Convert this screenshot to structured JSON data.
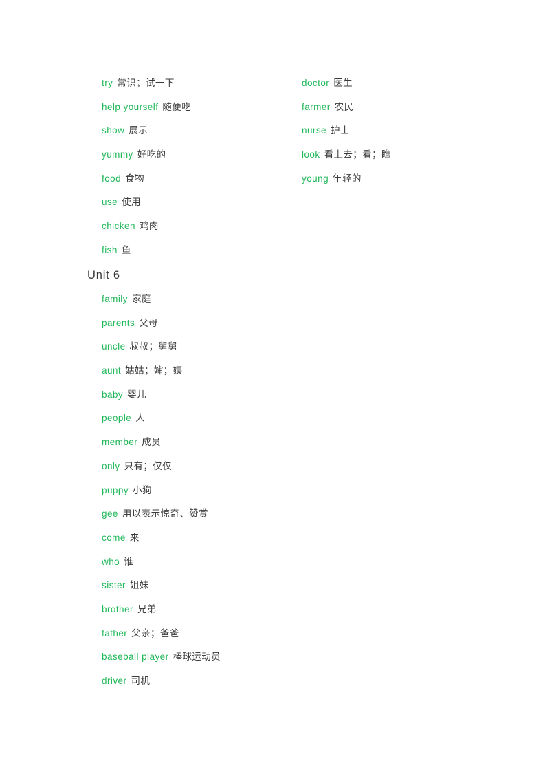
{
  "page": {
    "background_color": "#ffffff",
    "term_color": "#21b85a",
    "gloss_color": "#3b3b3b",
    "heading_color": "#3a3a3a"
  },
  "top_section": {
    "left_column": [
      {
        "term": "try",
        "gloss": "常识；试一下",
        "underlined": false
      },
      {
        "term": "help  yourself",
        "gloss": "随便吃",
        "underlined": false
      },
      {
        "term": "show",
        "gloss": "展示",
        "underlined": false
      },
      {
        "term": "yummy",
        "gloss": "好吃的",
        "underlined": false
      },
      {
        "term": "food",
        "gloss": "食物",
        "underlined": false
      },
      {
        "term": "use",
        "gloss": "使用",
        "underlined": false
      },
      {
        "term": "chicken",
        "gloss": "鸡肉",
        "underlined": false
      },
      {
        "term": "fish",
        "gloss": "鱼",
        "underlined": true
      }
    ],
    "right_column": [
      {
        "term": "doctor",
        "gloss": "医生",
        "underlined": false
      },
      {
        "term": "farmer",
        "gloss": "农民",
        "underlined": false
      },
      {
        "term": "nurse",
        "gloss": "护士",
        "underlined": false
      },
      {
        "term": "look",
        "gloss": "看上去；看；瞧",
        "underlined": false
      },
      {
        "term": "young",
        "gloss": "年轻的",
        "underlined": false
      }
    ]
  },
  "unit_section": {
    "heading": "Unit  6",
    "entries": [
      {
        "term": "family",
        "gloss": "家庭",
        "underlined": false
      },
      {
        "term": "parents",
        "gloss": "父母",
        "underlined": false
      },
      {
        "term": "uncle",
        "gloss": "叔叔；舅舅",
        "underlined": false
      },
      {
        "term": "aunt",
        "gloss": "姑姑；婶；姨",
        "underlined": false
      },
      {
        "term": "baby",
        "gloss": "婴儿",
        "underlined": false
      },
      {
        "term": "people",
        "gloss": "人",
        "underlined": false
      },
      {
        "term": "member",
        "gloss": "成员",
        "underlined": false
      },
      {
        "term": "only",
        "gloss": "只有；仅仅",
        "underlined": false
      },
      {
        "term": "puppy",
        "gloss": "小狗",
        "underlined": false
      },
      {
        "term": "gee",
        "gloss": "用以表示惊奇、赞赏",
        "underlined": false
      },
      {
        "term": "come",
        "gloss": "来",
        "underlined": false
      },
      {
        "term": "who",
        "gloss": "谁",
        "underlined": false
      },
      {
        "term": "sister",
        "gloss": "姐妹",
        "underlined": false
      },
      {
        "term": "brother",
        "gloss": "兄弟",
        "underlined": false
      },
      {
        "term": "father",
        "gloss": "父亲；爸爸",
        "underlined": false
      },
      {
        "term": "baseball  player",
        "gloss": "棒球运动员",
        "underlined": false
      },
      {
        "term": "driver",
        "gloss": "司机",
        "underlined": false
      }
    ]
  }
}
